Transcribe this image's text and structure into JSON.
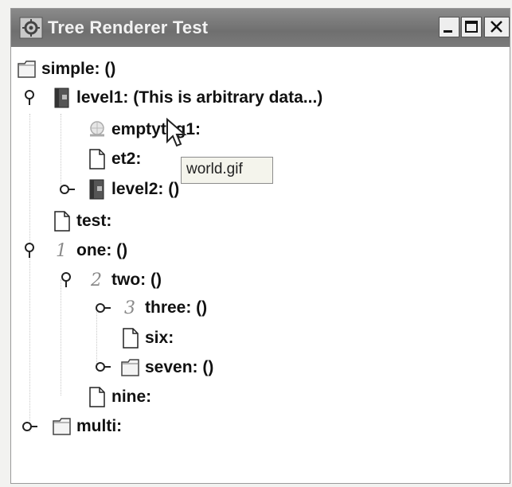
{
  "window": {
    "title": "Tree Renderer Test",
    "app_icon": "gear-icon",
    "controls": {
      "minimize": "minimize-icon",
      "maximize": "maximize-icon",
      "close": "close-icon"
    }
  },
  "tree": {
    "nodes": {
      "simple": "simple: ()",
      "level1": "level1: (This is arbitrary data...)",
      "emptytag1": "emptytag1:",
      "et2": "et2:",
      "level2": "level2: ()",
      "test": "test:",
      "one": "one: ()",
      "two": "two: ()",
      "three": "three: ()",
      "six": "six:",
      "seven": "seven: ()",
      "nine": "nine:",
      "multi": "multi:"
    },
    "number_icons": {
      "one": "1",
      "two": "2",
      "three": "3"
    }
  },
  "tooltip": {
    "text": "world.gif"
  }
}
